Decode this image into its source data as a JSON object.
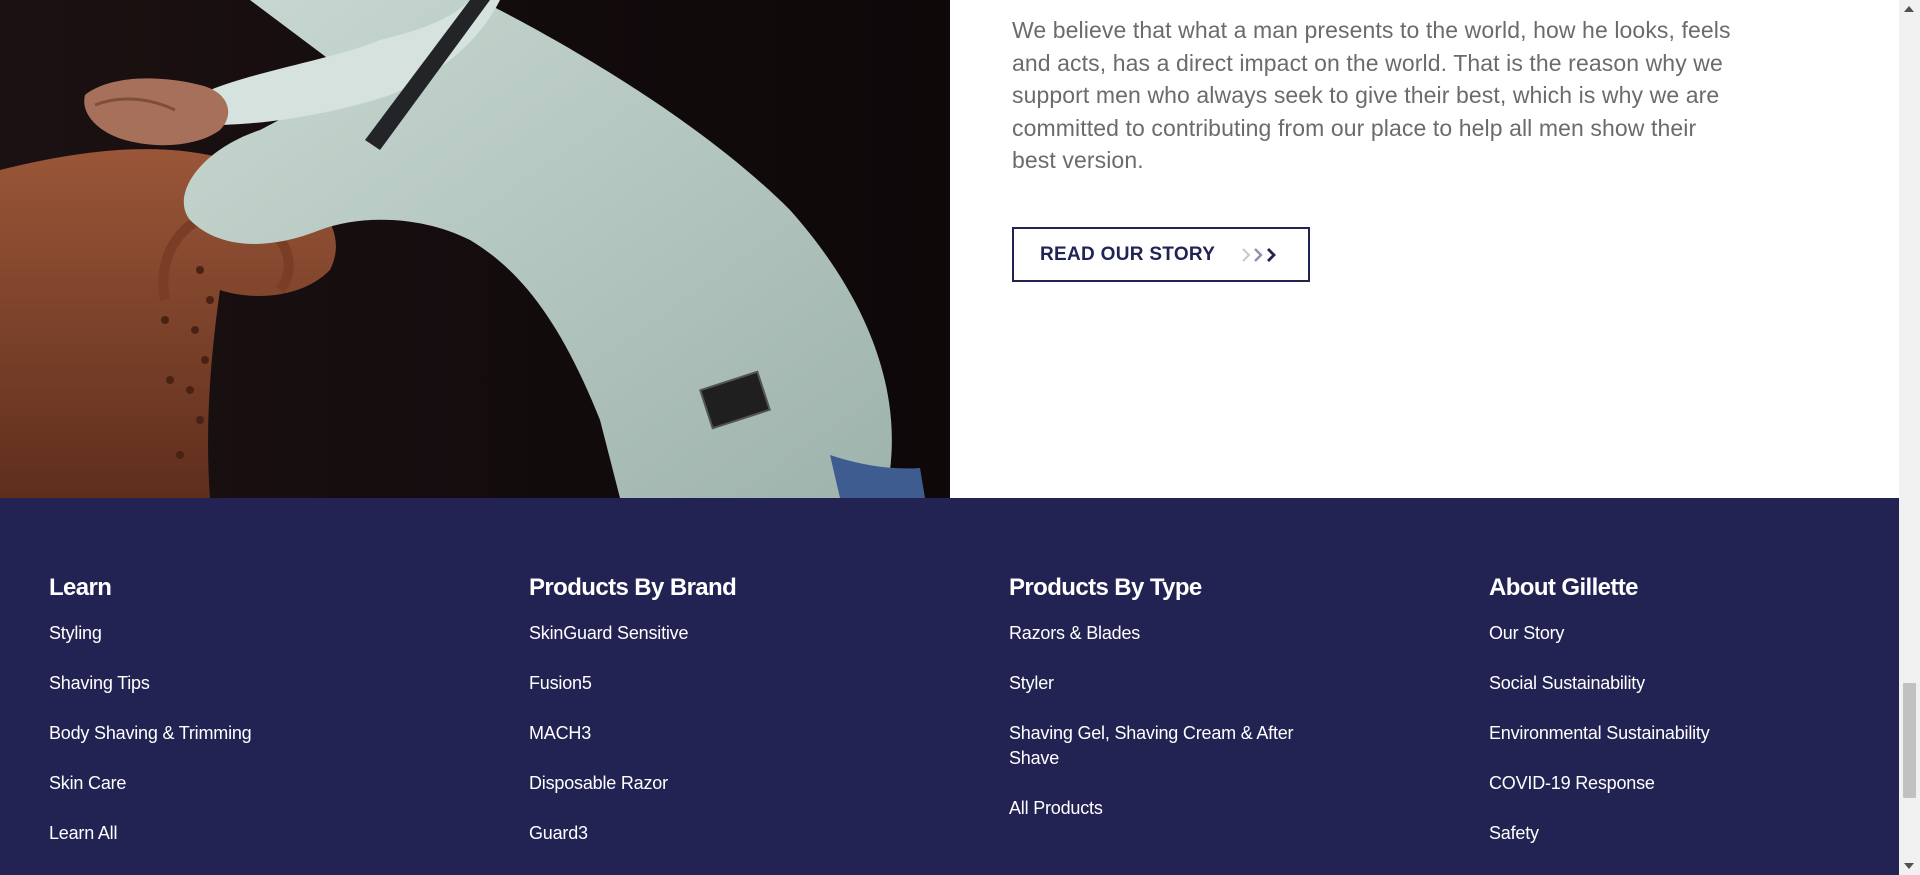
{
  "story": {
    "paragraph": "We believe that what a man presents to the world, how he looks, feels and acts, has a direct impact on the world. That is the reason why we support men who always seek to give their best, which is why we are committed to contributing from our place to help all men show their best version.",
    "button_label": "READ OUR STORY",
    "button_icon": "triple-chevron-right-icon"
  },
  "footer": {
    "columns": [
      {
        "heading": "Learn",
        "links": [
          "Styling",
          "Shaving Tips",
          "Body Shaving & Trimming",
          "Skin Care",
          "Learn All"
        ]
      },
      {
        "heading": "Products By Brand",
        "links": [
          "SkinGuard Sensitive",
          "Fusion5",
          "MACH3",
          "Disposable Razor",
          "Guard3"
        ]
      },
      {
        "heading": "Products By Type",
        "links": [
          "Razors & Blades",
          "Styler",
          "Shaving Gel, Shaving Cream & After Shave",
          "All Products"
        ]
      },
      {
        "heading": "About Gillette",
        "links": [
          "Our Story",
          "Social Sustainability",
          "Environmental Sustainability",
          "COVID-19 Response",
          "Safety"
        ]
      }
    ]
  },
  "colors": {
    "navy": "#222253",
    "text_gray": "#6b6b6b",
    "button_border": "#222355"
  }
}
